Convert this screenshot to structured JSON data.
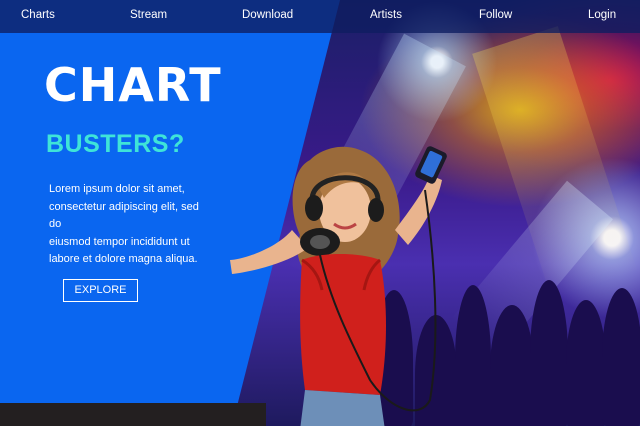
{
  "nav": {
    "items": [
      {
        "label": "Charts"
      },
      {
        "label": "Stream"
      },
      {
        "label": "Download"
      },
      {
        "label": "Artists"
      },
      {
        "label": "Follow"
      },
      {
        "label": "Login"
      }
    ]
  },
  "hero": {
    "title": "CHART",
    "subtitle": "BUSTERS?",
    "body_lines": [
      "Lorem ipsum dolor sit amet,",
      "consectetur adipiscing elit, sed do",
      "eiusmod tempor incididunt ut",
      "labore et dolore magna aliqua."
    ],
    "cta_label": "EXPLORE"
  },
  "colors": {
    "panel_blue": "#0a66f0",
    "subtitle_cyan": "#3ee4d8",
    "nav_bg": "#0e1e60",
    "footer_dark": "#231f20"
  },
  "images": {
    "background": "concert-crowd-stage-lights",
    "person": "woman-dancing-with-headphones-and-phone"
  }
}
